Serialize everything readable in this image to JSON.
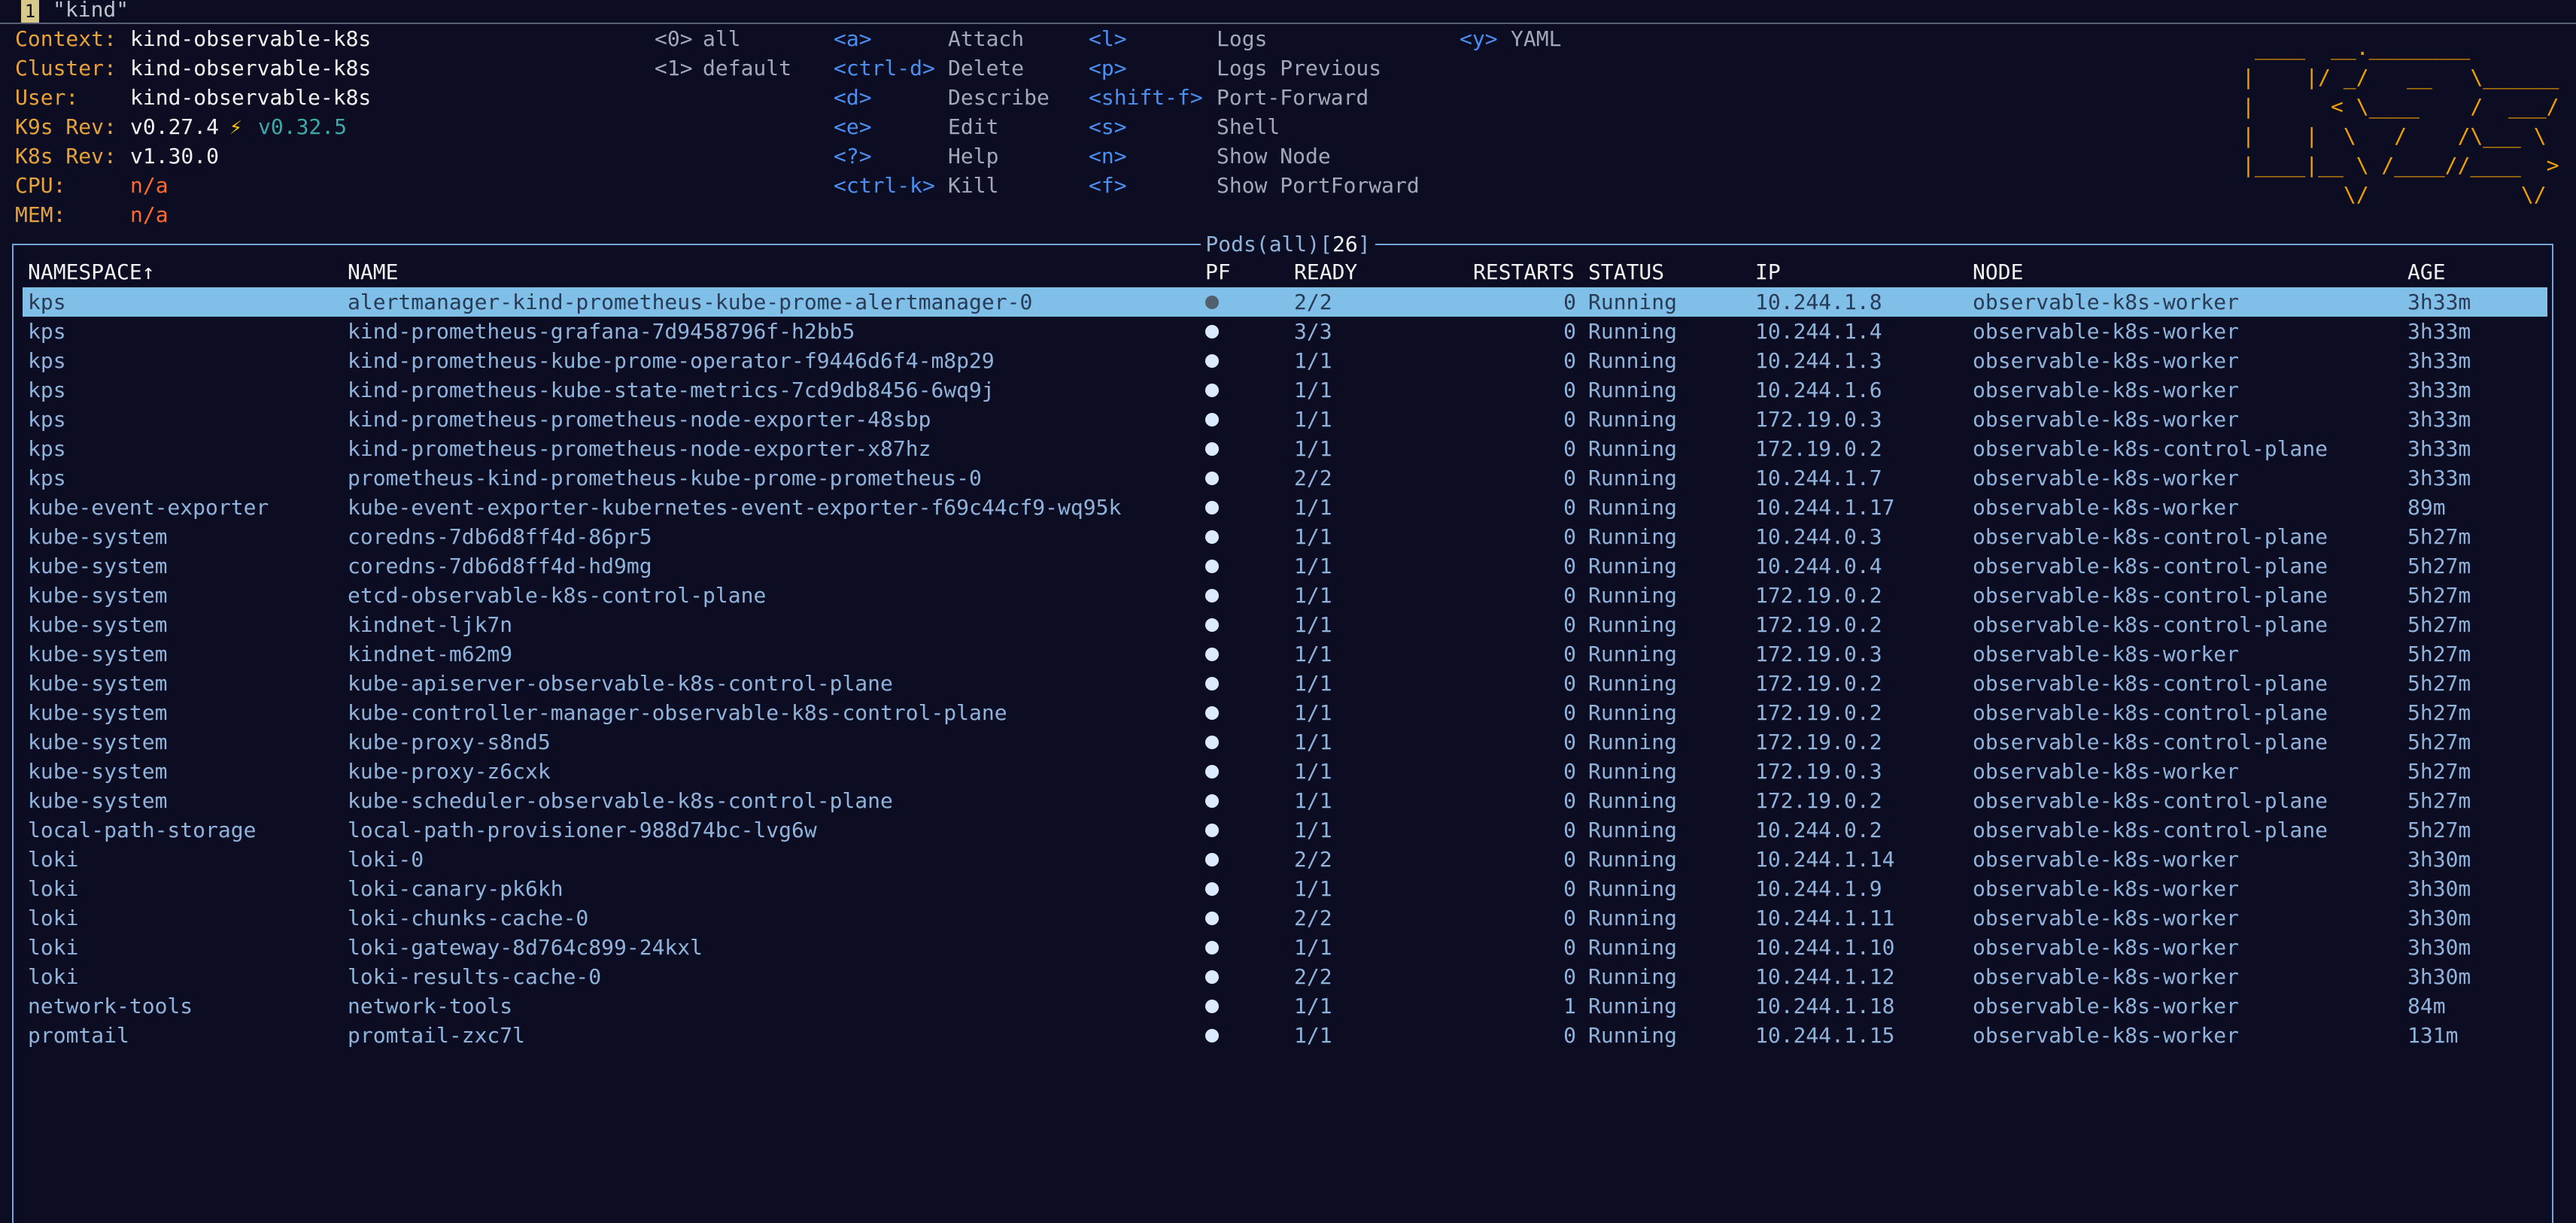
{
  "tab": {
    "number": "1",
    "title": "\"kind\""
  },
  "info": [
    {
      "label": "Context:",
      "value": "kind-observable-k8s",
      "style": "val"
    },
    {
      "label": "Cluster:",
      "value": "kind-observable-k8s",
      "style": "val"
    },
    {
      "label": "User:",
      "value": "kind-observable-k8s",
      "style": "val"
    },
    {
      "label": "K9s Rev:",
      "value": "v0.27.4",
      "style": "val",
      "upgrade": "v0.32.5"
    },
    {
      "label": "K8s Rev:",
      "value": "v1.30.0",
      "style": "val"
    },
    {
      "label": "CPU:",
      "value": "n/a",
      "style": "red"
    },
    {
      "label": "MEM:",
      "value": "n/a",
      "style": "red"
    }
  ],
  "bolt": "⚡",
  "namespace_shortcuts": [
    {
      "key": "<0>",
      "name": "all"
    },
    {
      "key": "<1>",
      "name": "default"
    }
  ],
  "hotkeys_col1": [
    {
      "key": "<a>",
      "action": "Attach"
    },
    {
      "key": "<ctrl-d>",
      "action": "Delete"
    },
    {
      "key": "<d>",
      "action": "Describe"
    },
    {
      "key": "<e>",
      "action": "Edit"
    },
    {
      "key": "<?>",
      "action": "Help"
    },
    {
      "key": "<ctrl-k>",
      "action": "Kill"
    }
  ],
  "hotkeys_col2": [
    {
      "key": "<l>",
      "action": "Logs"
    },
    {
      "key": "<p>",
      "action": "Logs Previous"
    },
    {
      "key": "<shift-f>",
      "action": "Port-Forward"
    },
    {
      "key": "<s>",
      "action": "Shell"
    },
    {
      "key": "<n>",
      "action": "Show Node"
    },
    {
      "key": "<f>",
      "action": "Show PortForward"
    }
  ],
  "hotkeys_col3": [
    {
      "key": "<y>",
      "action": "YAML"
    }
  ],
  "logo": [
    " ____  __.________        ",
    "|    |/ _/   __   \\______ ",
    "|      < \\____    /  ___/ ",
    "|    |  \\   /    /\\___ \\  ",
    "|____|__ \\ /____//____  > ",
    "        \\/            \\/  "
  ],
  "frame_title": {
    "resource": "Pods",
    "scope": "(all)",
    "count": "26"
  },
  "columns": {
    "namespace": "NAMESPACE↑",
    "name": "NAME",
    "pf": "PF",
    "ready": "READY",
    "restarts": "RESTARTS",
    "status": "STATUS",
    "ip": "IP",
    "node": "NODE",
    "age": "AGE"
  },
  "selected_index": 0,
  "pods": [
    {
      "namespace": "kps",
      "name": "alertmanager-kind-prometheus-kube-prome-alertmanager-0",
      "ready": "2/2",
      "restarts": "0",
      "status": "Running",
      "ip": "10.244.1.8",
      "node": "observable-k8s-worker",
      "age": "3h33m"
    },
    {
      "namespace": "kps",
      "name": "kind-prometheus-grafana-7d9458796f-h2bb5",
      "ready": "3/3",
      "restarts": "0",
      "status": "Running",
      "ip": "10.244.1.4",
      "node": "observable-k8s-worker",
      "age": "3h33m"
    },
    {
      "namespace": "kps",
      "name": "kind-prometheus-kube-prome-operator-f9446d6f4-m8p29",
      "ready": "1/1",
      "restarts": "0",
      "status": "Running",
      "ip": "10.244.1.3",
      "node": "observable-k8s-worker",
      "age": "3h33m"
    },
    {
      "namespace": "kps",
      "name": "kind-prometheus-kube-state-metrics-7cd9db8456-6wq9j",
      "ready": "1/1",
      "restarts": "0",
      "status": "Running",
      "ip": "10.244.1.6",
      "node": "observable-k8s-worker",
      "age": "3h33m"
    },
    {
      "namespace": "kps",
      "name": "kind-prometheus-prometheus-node-exporter-48sbp",
      "ready": "1/1",
      "restarts": "0",
      "status": "Running",
      "ip": "172.19.0.3",
      "node": "observable-k8s-worker",
      "age": "3h33m"
    },
    {
      "namespace": "kps",
      "name": "kind-prometheus-prometheus-node-exporter-x87hz",
      "ready": "1/1",
      "restarts": "0",
      "status": "Running",
      "ip": "172.19.0.2",
      "node": "observable-k8s-control-plane",
      "age": "3h33m"
    },
    {
      "namespace": "kps",
      "name": "prometheus-kind-prometheus-kube-prome-prometheus-0",
      "ready": "2/2",
      "restarts": "0",
      "status": "Running",
      "ip": "10.244.1.7",
      "node": "observable-k8s-worker",
      "age": "3h33m"
    },
    {
      "namespace": "kube-event-exporter",
      "name": "kube-event-exporter-kubernetes-event-exporter-f69c44cf9-wq95k",
      "ready": "1/1",
      "restarts": "0",
      "status": "Running",
      "ip": "10.244.1.17",
      "node": "observable-k8s-worker",
      "age": "89m"
    },
    {
      "namespace": "kube-system",
      "name": "coredns-7db6d8ff4d-86pr5",
      "ready": "1/1",
      "restarts": "0",
      "status": "Running",
      "ip": "10.244.0.3",
      "node": "observable-k8s-control-plane",
      "age": "5h27m"
    },
    {
      "namespace": "kube-system",
      "name": "coredns-7db6d8ff4d-hd9mg",
      "ready": "1/1",
      "restarts": "0",
      "status": "Running",
      "ip": "10.244.0.4",
      "node": "observable-k8s-control-plane",
      "age": "5h27m"
    },
    {
      "namespace": "kube-system",
      "name": "etcd-observable-k8s-control-plane",
      "ready": "1/1",
      "restarts": "0",
      "status": "Running",
      "ip": "172.19.0.2",
      "node": "observable-k8s-control-plane",
      "age": "5h27m"
    },
    {
      "namespace": "kube-system",
      "name": "kindnet-ljk7n",
      "ready": "1/1",
      "restarts": "0",
      "status": "Running",
      "ip": "172.19.0.2",
      "node": "observable-k8s-control-plane",
      "age": "5h27m"
    },
    {
      "namespace": "kube-system",
      "name": "kindnet-m62m9",
      "ready": "1/1",
      "restarts": "0",
      "status": "Running",
      "ip": "172.19.0.3",
      "node": "observable-k8s-worker",
      "age": "5h27m"
    },
    {
      "namespace": "kube-system",
      "name": "kube-apiserver-observable-k8s-control-plane",
      "ready": "1/1",
      "restarts": "0",
      "status": "Running",
      "ip": "172.19.0.2",
      "node": "observable-k8s-control-plane",
      "age": "5h27m"
    },
    {
      "namespace": "kube-system",
      "name": "kube-controller-manager-observable-k8s-control-plane",
      "ready": "1/1",
      "restarts": "0",
      "status": "Running",
      "ip": "172.19.0.2",
      "node": "observable-k8s-control-plane",
      "age": "5h27m"
    },
    {
      "namespace": "kube-system",
      "name": "kube-proxy-s8nd5",
      "ready": "1/1",
      "restarts": "0",
      "status": "Running",
      "ip": "172.19.0.2",
      "node": "observable-k8s-control-plane",
      "age": "5h27m"
    },
    {
      "namespace": "kube-system",
      "name": "kube-proxy-z6cxk",
      "ready": "1/1",
      "restarts": "0",
      "status": "Running",
      "ip": "172.19.0.3",
      "node": "observable-k8s-worker",
      "age": "5h27m"
    },
    {
      "namespace": "kube-system",
      "name": "kube-scheduler-observable-k8s-control-plane",
      "ready": "1/1",
      "restarts": "0",
      "status": "Running",
      "ip": "172.19.0.2",
      "node": "observable-k8s-control-plane",
      "age": "5h27m"
    },
    {
      "namespace": "local-path-storage",
      "name": "local-path-provisioner-988d74bc-lvg6w",
      "ready": "1/1",
      "restarts": "0",
      "status": "Running",
      "ip": "10.244.0.2",
      "node": "observable-k8s-control-plane",
      "age": "5h27m"
    },
    {
      "namespace": "loki",
      "name": "loki-0",
      "ready": "2/2",
      "restarts": "0",
      "status": "Running",
      "ip": "10.244.1.14",
      "node": "observable-k8s-worker",
      "age": "3h30m"
    },
    {
      "namespace": "loki",
      "name": "loki-canary-pk6kh",
      "ready": "1/1",
      "restarts": "0",
      "status": "Running",
      "ip": "10.244.1.9",
      "node": "observable-k8s-worker",
      "age": "3h30m"
    },
    {
      "namespace": "loki",
      "name": "loki-chunks-cache-0",
      "ready": "2/2",
      "restarts": "0",
      "status": "Running",
      "ip": "10.244.1.11",
      "node": "observable-k8s-worker",
      "age": "3h30m"
    },
    {
      "namespace": "loki",
      "name": "loki-gateway-8d764c899-24kxl",
      "ready": "1/1",
      "restarts": "0",
      "status": "Running",
      "ip": "10.244.1.10",
      "node": "observable-k8s-worker",
      "age": "3h30m"
    },
    {
      "namespace": "loki",
      "name": "loki-results-cache-0",
      "ready": "2/2",
      "restarts": "0",
      "status": "Running",
      "ip": "10.244.1.12",
      "node": "observable-k8s-worker",
      "age": "3h30m"
    },
    {
      "namespace": "network-tools",
      "name": "network-tools",
      "ready": "1/1",
      "restarts": "1",
      "status": "Running",
      "ip": "10.244.1.18",
      "node": "observable-k8s-worker",
      "age": "84m"
    },
    {
      "namespace": "promtail",
      "name": "promtail-zxc7l",
      "ready": "1/1",
      "restarts": "0",
      "status": "Running",
      "ip": "10.244.1.15",
      "node": "observable-k8s-worker",
      "age": "131m"
    }
  ]
}
